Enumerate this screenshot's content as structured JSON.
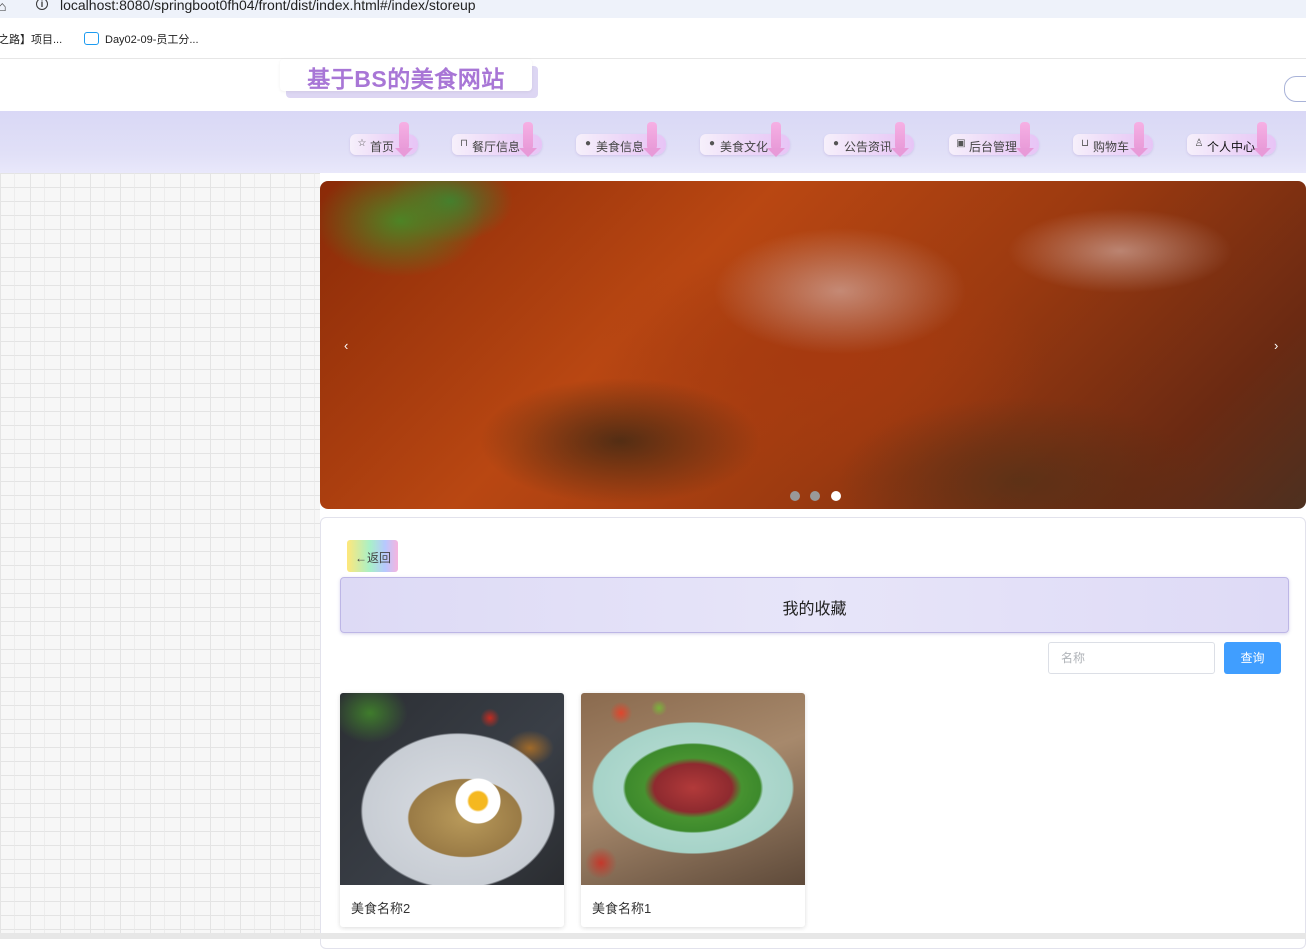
{
  "browser": {
    "url": "localhost:8080/springboot0fh04/front/dist/index.html#/index/storeup",
    "bookmarks": [
      {
        "label": "之路】项目..."
      },
      {
        "label": "Day02-09-员工分..."
      }
    ]
  },
  "header": {
    "site_title": "基于BS的美食网站"
  },
  "nav": {
    "items": [
      {
        "label": "首页",
        "icon": "star-icon"
      },
      {
        "label": "餐厅信息",
        "icon": "bag-icon"
      },
      {
        "label": "美食信息",
        "icon": "info-circle-icon"
      },
      {
        "label": "美食文化",
        "icon": "question-circle-icon"
      },
      {
        "label": "公告资讯",
        "icon": "info-circle-icon"
      },
      {
        "label": "后台管理",
        "icon": "clipboard-icon"
      },
      {
        "label": "购物车",
        "icon": "cart-icon"
      },
      {
        "label": "个人中心",
        "icon": "user-icon"
      }
    ],
    "active_index": 7
  },
  "carousel": {
    "prev_glyph": "‹",
    "next_glyph": "›",
    "slide_count": 3,
    "active_slide": 3
  },
  "content": {
    "back_label": "←返回",
    "section_title": "我的收藏",
    "search_placeholder": "名称",
    "search_value": "",
    "query_label": "查询",
    "items": [
      {
        "name": "美食名称2"
      },
      {
        "name": "美食名称1"
      }
    ]
  },
  "colors": {
    "accent_blue": "#409eff",
    "title_purple": "#a876d6",
    "nav_band": "#dcdaf6"
  }
}
